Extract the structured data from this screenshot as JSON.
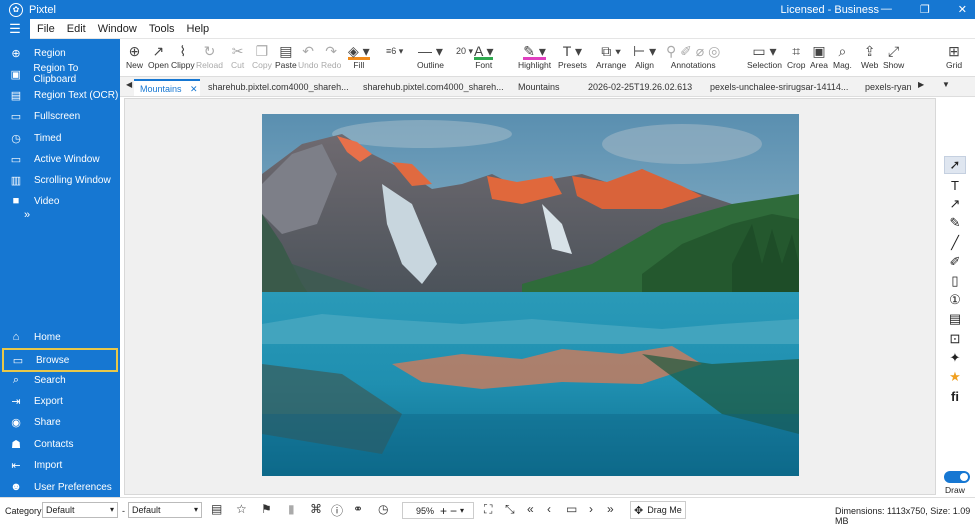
{
  "titlebar": {
    "app_title": "Pixtel",
    "license": "Licensed - Business",
    "minimize": "—",
    "restore": "❐",
    "close": "✕"
  },
  "menu": [
    "File",
    "Edit",
    "Window",
    "Tools",
    "Help"
  ],
  "sidebar": {
    "capture": [
      "Region",
      "Region To Clipboard",
      "Region Text (OCR)",
      "Fullscreen",
      "Timed",
      "Active Window",
      "Scrolling Window",
      "Video"
    ],
    "more": "»",
    "nav": [
      "Home",
      "Browse",
      "Search",
      "Export",
      "Share",
      "Contacts",
      "Import",
      "User Preferences"
    ],
    "selected": "Browse"
  },
  "toolbar": {
    "new": "New",
    "open": "Open",
    "clippy": "Clippy",
    "reload": "Reload",
    "cut": "Cut",
    "copy": "Copy",
    "paste": "Paste",
    "undo": "Undo",
    "redo": "Redo",
    "fill": "Fill",
    "outline_width": "6",
    "outline": "Outline",
    "font_size": "20",
    "font": "Font",
    "highlight": "Highlight",
    "presets": "Presets",
    "arrange": "Arrange",
    "align": "Align",
    "annotations": "Annotations",
    "selection": "Selection",
    "crop": "Crop",
    "area": "Area",
    "mag": "Mag.",
    "web": "Web",
    "show": "Show",
    "grid": "Grid"
  },
  "tabs": [
    "Mountains",
    "sharehub.pixtel.com4000_shareh...",
    "sharehub.pixtel.com4000_shareh...",
    "Mountains",
    "2026-02-25T19.26.02.613",
    "pexels-unchalee-srirugsar-14114...",
    "pexels-ryan"
  ],
  "right_panel": {
    "draw_label": "Draw"
  },
  "statusbar": {
    "category_label": "Category",
    "category_value": "Default",
    "separator": "-",
    "style_value": "Default",
    "zoom": "95%",
    "drag_me": "Drag Me",
    "dimensions": "Dimensions: 1113x750, Size: 1.09 MB"
  },
  "colors": {
    "brand": "#1677d2",
    "selected_outline": "#e8c84a",
    "fill_swatch": "#f08a1a",
    "font_swatch": "#2fa84f",
    "highlight_swatch": "#e040c0",
    "star": "#f0a020"
  }
}
